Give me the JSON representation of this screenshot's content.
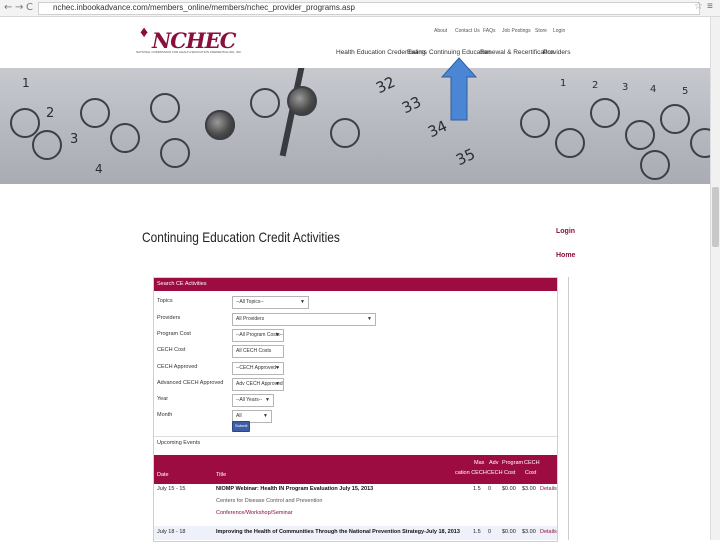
{
  "browser": {
    "back": "←",
    "forward": "→",
    "reload": "C",
    "url": "nchec.inbookadvance.com/members_online/members/nchec_provider_programs.asp"
  },
  "logo": {
    "text": "NCHEC",
    "subtitle": "NATIONAL COMMISSION FOR HEALTH EDUCATION CREDENTIALING, INC."
  },
  "top_links": [
    "About",
    "Contact Us",
    "FAQs",
    "Job Postings",
    "Store",
    "Login"
  ],
  "main_nav": [
    "Health Education Credentialing",
    "Exams",
    "Continuing Education",
    "Renewal & Recertification",
    "Providers"
  ],
  "hero_numbers": [
    "1",
    "2",
    "3",
    "4",
    "32",
    "33",
    "34",
    "35",
    "1",
    "2",
    "3",
    "4",
    "5"
  ],
  "page": {
    "title": "Continuing Education Credit Activities",
    "login": "Login",
    "home": "Home"
  },
  "search": {
    "header": "Search CE Activities",
    "fields": [
      {
        "label": "Topics",
        "value": "--All Topics--"
      },
      {
        "label": "Providers",
        "value": "All Providers"
      },
      {
        "label": "Program Cost",
        "value": "--All Program Costs--"
      },
      {
        "label": "CECH Cost",
        "value": "All CECH Costs"
      },
      {
        "label": "CECH Approved",
        "value": "--CECH Approved--"
      },
      {
        "label": "Advanced CECH Approved",
        "value": "Adv CECH Approved"
      },
      {
        "label": "Year",
        "value": "--All Years--"
      },
      {
        "label": "Month",
        "value": "All"
      }
    ],
    "submit": "Submit"
  },
  "upcoming": {
    "label": "Upcoming Events",
    "headers": {
      "date": "Date",
      "title": "Title",
      "max_cech": "Max\ncation CECH",
      "adv_cech": "Adv\nCECH",
      "program_cost": "Program\nCost",
      "cech_cost": "CECH\nCost"
    },
    "header_lines": {
      "c1a": "Max",
      "c1b": "cation CECH",
      "c2a": "Adv",
      "c2b": "CECH",
      "c3a": "Program",
      "c3b": "Cost",
      "c4a": "CECH",
      "c4b": "Cost"
    },
    "rows": [
      {
        "date": "July 15 - 15",
        "title": "NIOMP Webinar: Health IN Program Evaluation July 15, 2013",
        "subtitle": "Centers for Disease Control and Prevention",
        "org": "Conference/Workshop/Seminar",
        "max_cech": "1.5",
        "adv_cech": "0",
        "program_cost": "$0.00",
        "cech_cost": "$3.00",
        "details": "Details"
      },
      {
        "date": "July 18 - 18",
        "title": "Improving the Health of Communities Through the National Prevention Strategy-July 18, 2013",
        "subtitle": "",
        "org": "",
        "max_cech": "1.5",
        "adv_cech": "0",
        "program_cost": "$0.00",
        "cech_cost": "$3.00",
        "details": "Details"
      }
    ]
  },
  "colors": {
    "brand": "#9c0c41",
    "arrow": "#4a86d4",
    "submit": "#3d5da6"
  },
  "icons": [
    "back-icon",
    "forward-icon",
    "reload-icon",
    "star-icon",
    "menu-icon",
    "up-arrow-icon"
  ]
}
